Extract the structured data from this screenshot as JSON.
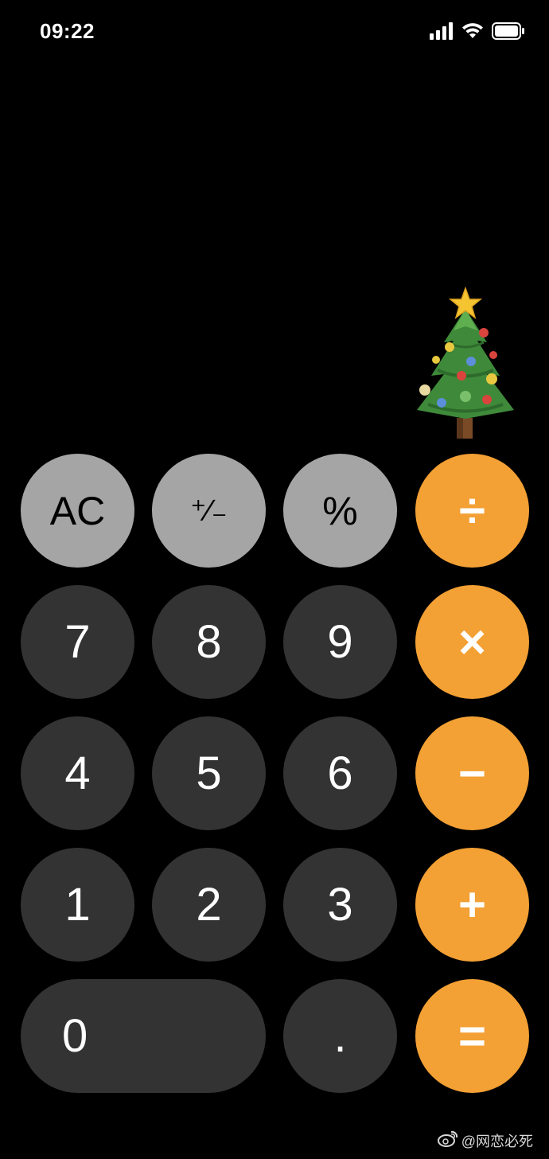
{
  "status_bar": {
    "time": "09:22",
    "signal_icon": "signal-bars-icon",
    "wifi_icon": "wifi-icon",
    "battery_icon": "battery-icon"
  },
  "display": {
    "content": "christmas-tree-emoji"
  },
  "keys": {
    "ac": "AC",
    "plus_minus": "⁺∕₋",
    "percent": "%",
    "divide": "÷",
    "seven": "7",
    "eight": "8",
    "nine": "9",
    "multiply": "×",
    "four": "4",
    "five": "5",
    "six": "6",
    "minus": "−",
    "one": "1",
    "two": "2",
    "three": "3",
    "plus": "+",
    "zero": "0",
    "decimal": ".",
    "equals": "="
  },
  "colors": {
    "function_key": "#a5a5a5",
    "digit_key": "#333333",
    "operator_key": "#f3a034",
    "background": "#000000"
  },
  "watermark": {
    "logo": "weibo-icon",
    "text": "@网恋必死"
  }
}
